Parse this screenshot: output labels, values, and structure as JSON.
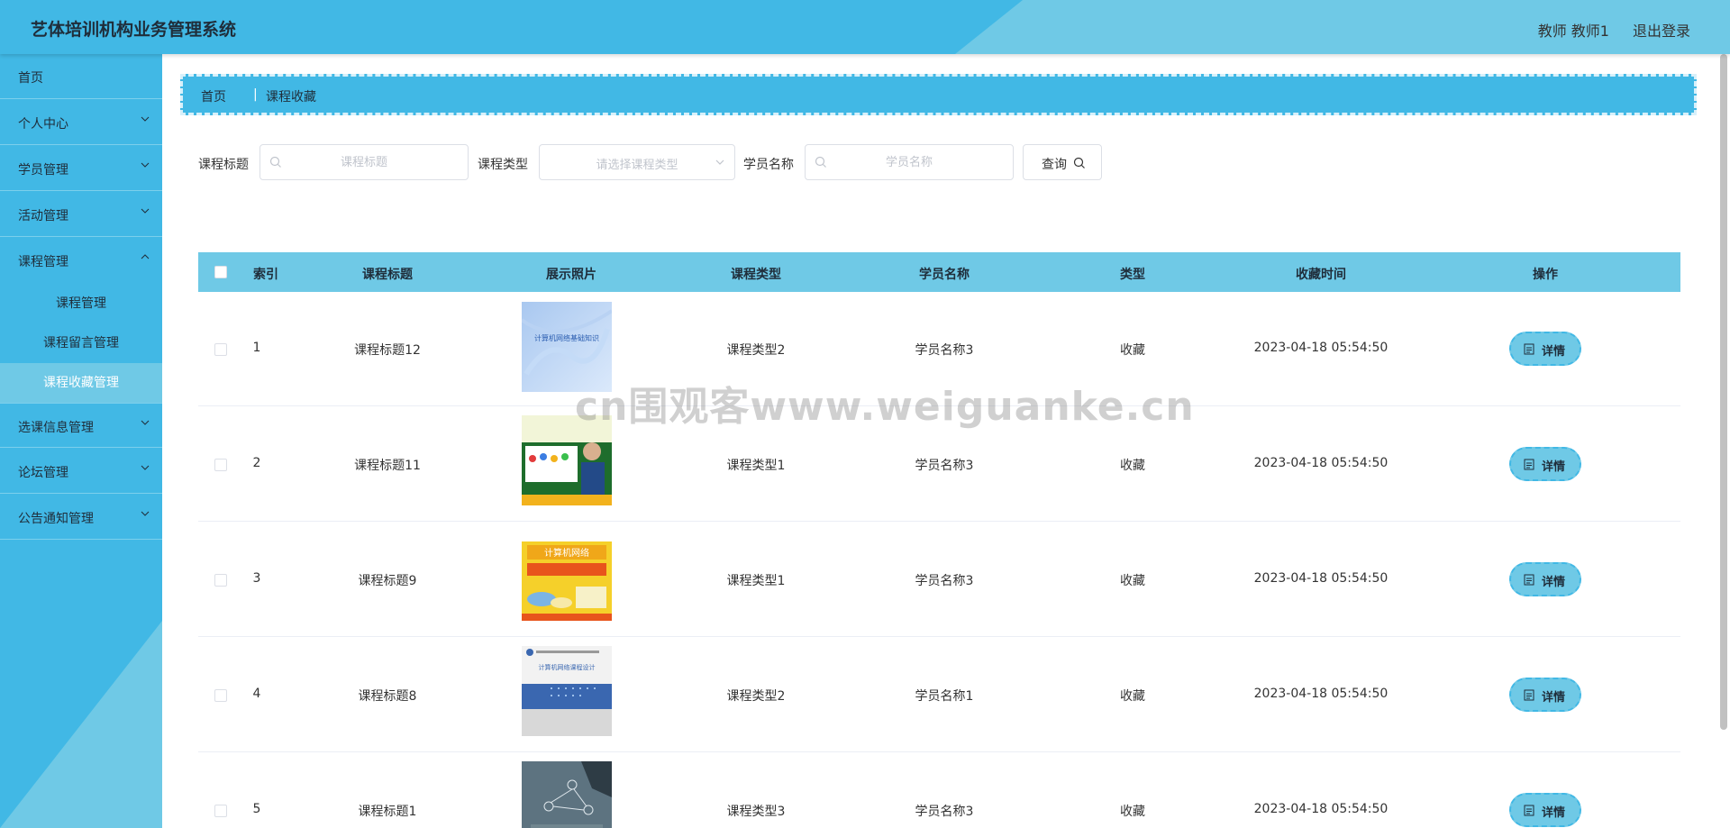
{
  "header": {
    "title": "艺体培训机构业务管理系统",
    "user": "教师 教师1",
    "logout": "退出登录"
  },
  "sidebar": {
    "items": [
      {
        "label": "首页"
      },
      {
        "label": "个人中心"
      },
      {
        "label": "学员管理"
      },
      {
        "label": "活动管理"
      },
      {
        "label": "课程管理"
      },
      {
        "label": "选课信息管理"
      },
      {
        "label": "论坛管理"
      },
      {
        "label": "公告通知管理"
      }
    ],
    "subitems": [
      {
        "label": "课程管理"
      },
      {
        "label": "课程留言管理"
      },
      {
        "label": "课程收藏管理"
      }
    ]
  },
  "breadcrumb": {
    "home": "首页",
    "current": "课程收藏"
  },
  "search": {
    "title_label": "课程标题",
    "title_placeholder": "课程标题",
    "type_label": "课程类型",
    "type_placeholder": "请选择课程类型",
    "student_label": "学员名称",
    "student_placeholder": "学员名称",
    "query": "查询"
  },
  "table": {
    "headers": [
      "索引",
      "课程标题",
      "展示照片",
      "课程类型",
      "学员名称",
      "类型",
      "收藏时间",
      "操作"
    ],
    "detail_label": "详情",
    "rows": [
      {
        "index": "1",
        "title": "课程标题12",
        "course_type": "课程类型2",
        "student": "学员名称3",
        "kind": "收藏",
        "time": "2023-04-18 05:54:50",
        "photo_text": "计算机网络基础知识"
      },
      {
        "index": "2",
        "title": "课程标题11",
        "course_type": "课程类型1",
        "student": "学员名称3",
        "kind": "收藏",
        "time": "2023-04-18 05:54:50",
        "photo_text": ""
      },
      {
        "index": "3",
        "title": "课程标题9",
        "course_type": "课程类型1",
        "student": "学员名称3",
        "kind": "收藏",
        "time": "2023-04-18 05:54:50",
        "photo_text": "计算机网络"
      },
      {
        "index": "4",
        "title": "课程标题8",
        "course_type": "课程类型2",
        "student": "学员名称1",
        "kind": "收藏",
        "time": "2023-04-18 05:54:50",
        "photo_text": "计算机网络课程设计"
      },
      {
        "index": "5",
        "title": "课程标题1",
        "course_type": "课程类型3",
        "student": "学员名称3",
        "kind": "收藏",
        "time": "2023-04-18 05:54:50",
        "photo_text": ""
      }
    ]
  },
  "watermark": "cn围观客www.weiguanke.cn",
  "colors": {
    "primary": "#41b8e5",
    "light": "#6fc9e6"
  }
}
